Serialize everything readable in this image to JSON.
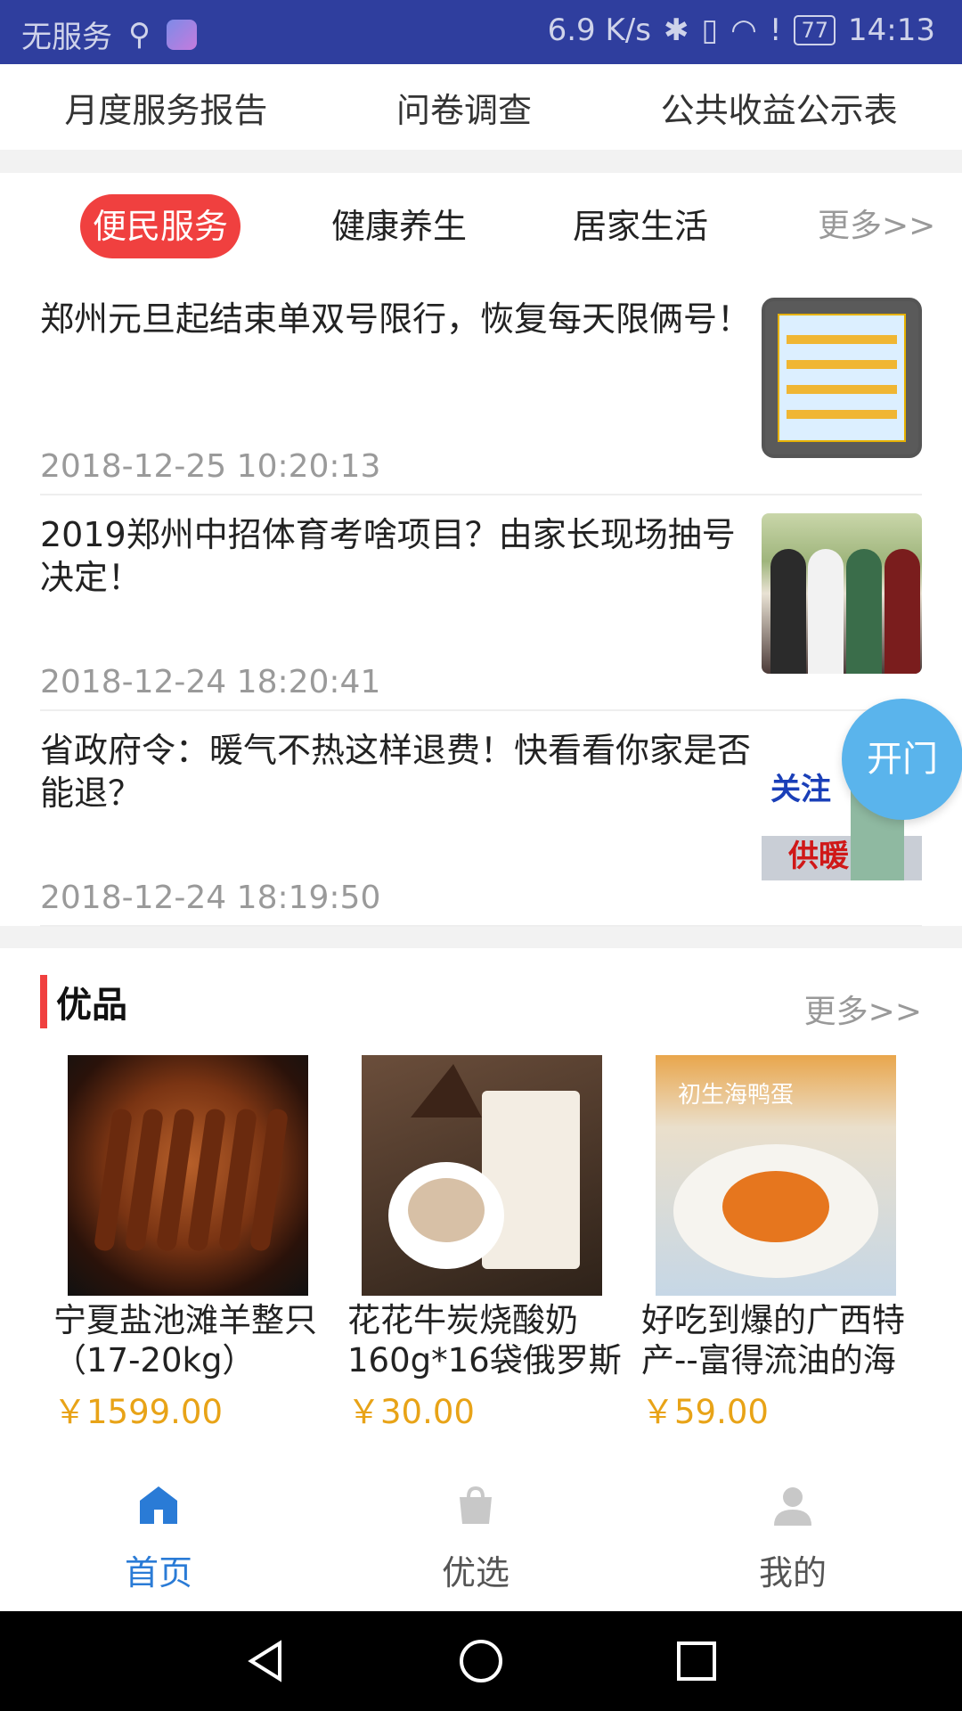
{
  "status_bar": {
    "carrier": "无服务",
    "speed": "6.9 K/s",
    "battery": "77",
    "time": "14:13"
  },
  "top_links": [
    "月度服务报告",
    "问卷调查",
    "公共收益公示表"
  ],
  "news": {
    "tabs": [
      "便民服务",
      "健康养生",
      "居家生活"
    ],
    "active_tab": "便民服务",
    "more": "更多>>",
    "items": [
      {
        "title": "郑州元旦起结束单双号限行，恢复每天限俩号！",
        "time": "2018-12-25 10:20:13"
      },
      {
        "title": "2019郑州中招体育考啥项目？由家长现场抽号决定！",
        "time": "2018-12-24 18:20:41"
      },
      {
        "title": "省政府令：暖气不热这样退费！快看看你家是否能退？",
        "time": "2018-12-24 18:19:50"
      }
    ],
    "thumb3_text": {
      "line1": "关注",
      "line2": "供暖"
    }
  },
  "float_button": "开门",
  "products": {
    "title": "优品",
    "more": "更多>>",
    "items": [
      {
        "name": "宁夏盐池滩羊整只（17-20kg）",
        "price": "￥1599.00"
      },
      {
        "name": "花花牛炭烧酸奶160g*16袋俄罗斯",
        "price": "￥30.00"
      },
      {
        "name": "好吃到爆的广西特产--富得流油的海",
        "price": "￥59.00"
      }
    ],
    "egg_brand": "初生海鸭蛋"
  },
  "bottom_nav": {
    "items": [
      "首页",
      "优选",
      "我的"
    ],
    "active": "首页"
  },
  "colors": {
    "status_bar": "#2f3e9e",
    "accent_red": "#f0403f",
    "price": "#e8a317",
    "nav_active": "#2a7bd6",
    "float_button": "#5ab4ec"
  }
}
